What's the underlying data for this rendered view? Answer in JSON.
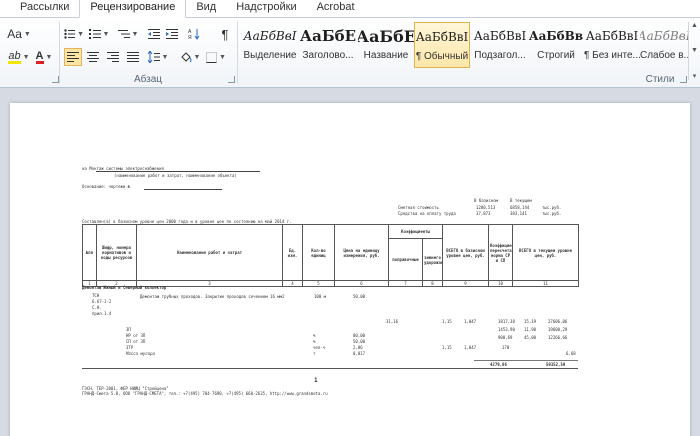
{
  "ribbon_tabs": [
    "Рассылки",
    "Рецензирование",
    "Вид",
    "Надстройки",
    "Acrobat"
  ],
  "font_group": {
    "change_case": "Aa",
    "highlight": "ab",
    "font_color": "A"
  },
  "paragraph_group": {
    "label": "Абзац",
    "show_marks": "¶"
  },
  "styles_group": {
    "label": "Стили",
    "items": [
      {
        "sample": "АаБбВвІ",
        "name": "Выделение"
      },
      {
        "sample": "АаБбЕ",
        "name": "Заголово..."
      },
      {
        "sample": "АаБбЕ",
        "name": "Название"
      },
      {
        "sample": "АаБбВвІ",
        "name": "¶ Обычный"
      },
      {
        "sample": "АаБбВвІ",
        "name": "Подзагол..."
      },
      {
        "sample": "АаБбВв",
        "name": "Строгий"
      },
      {
        "sample": "АаБбВвІ",
        "name": "¶ Без инте..."
      },
      {
        "sample": "АаБбВвІ",
        "name": "Слабое в..."
      }
    ]
  },
  "document": {
    "header_lines": [
      "на Монтаж системы электроснабжения",
      "(наименование работ и затрат, наименование объекта)",
      "Основание: чертежи №"
    ],
    "totals_header": [
      "В базисном",
      "В текущем"
    ],
    "totals_rows": [
      {
        "label": "Сметная стоимость",
        "base": "1280,513",
        "current": "6858,144",
        "unit": "тыс.руб."
      },
      {
        "label": "Средства на оплату труда",
        "base": "37,873",
        "current": "383,141",
        "unit": "тыс.руб."
      }
    ],
    "compiled_line": "Составлен(а) в базисном уровне цен 2000 года и в уровне цен по состоянию на май 2014 г.",
    "table": {
      "headers": [
        "№пп",
        "Шифр, номера нормативов и коды ресурсов",
        "Наименование работ и затрат",
        "Ед. изм.",
        "Кол-во единиц",
        "Цена на единицу измерения, руб.",
        "Коэффициенты",
        "ВСЕГО в базисном уровне цен, руб.",
        "Коэффициенты пересчета, норма СР и СП",
        "ВСЕГО в текущем уровне цен, руб."
      ],
      "coef_sub": [
        "поправочные",
        "зимнего удорожания"
      ],
      "numbers": [
        "1",
        "2",
        "3",
        "4",
        "5",
        "6",
        "7",
        "8",
        "9",
        "10",
        "11"
      ],
      "section_title": "Демонтаж Южный и Северный коллектор",
      "item_code": [
        "ТСН",
        "6.67-1-2",
        "С.Н.",
        "прил.1.4"
      ],
      "item_name": "Демонтаж трубных проходов. Закрытие проходов сечением 16 мм2",
      "item_unit": "100 м",
      "item_qty": "50,00",
      "rows": [
        {
          "name": "ЗП",
          "unit": "",
          "qty": "",
          "price": "31,16",
          "k1": "1,15",
          "k2": "1,047",
          "total": "1817,38",
          "coef": "15,19",
          "cur": "27606,06"
        },
        {
          "name": "НР от ЗП",
          "unit": "%",
          "qty": "80,00",
          "price": "",
          "k1": "",
          "k2": "",
          "total": "1453,90",
          "coef": "11,90",
          "cur": "19600,29"
        },
        {
          "name": "СП от ЗП",
          "unit": "%",
          "qty": "50,00",
          "price": "",
          "k1": "",
          "k2": "",
          "total": "908,69",
          "coef": "45,00",
          "cur": "12266,66"
        },
        {
          "name": "ЗТР",
          "unit": "чел-ч",
          "qty": "2,86",
          "price": "",
          "k1": "1,15",
          "k2": "1,047",
          "total": "170",
          "coef": "",
          "cur": ""
        },
        {
          "name": "Масса мусора",
          "unit": "т",
          "qty": "0,017",
          "price": "",
          "k1": "",
          "k2": "",
          "total": "",
          "coef": "",
          "cur": "6,68"
        }
      ],
      "totals": {
        "base": "4279,86",
        "current": "59352,59"
      }
    },
    "page_number": "1",
    "footer_lines": [
      "ГЭСН, ТЕР-2001, ФЕР НИИЦ \"Стройцена\"",
      "ГРАНД-Смета 5.0, ООО \"ГРАНД-СМЕТА\", тел.: +7(495) 784-7690, +7(495) 660-2635, http://www.grandsmeta.ru"
    ]
  }
}
